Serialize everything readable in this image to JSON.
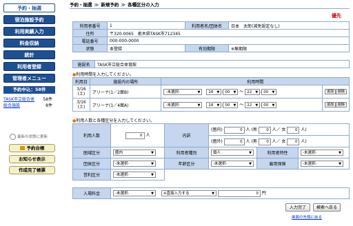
{
  "sidebar": {
    "nav": [
      "予約・抽選",
      "宿泊施設予約",
      "利用実績入力",
      "料金収納",
      "統計",
      "利用者登録",
      "管理者メニュー"
    ],
    "reserve_header": "予約中込：58件",
    "reserve_list": [
      {
        "name": "TASK市立総合体",
        "count": "58件"
      },
      {
        "name": "総合施設",
        "count": "8件"
      }
    ],
    "refresh": "最新の状態に更新",
    "buttons": [
      "予約台帳",
      "お知らせ表示",
      "作成完了帳票"
    ]
  },
  "breadcrumb": [
    "予約・抽選",
    "新規予約",
    "各種区分の入力"
  ],
  "priority": "優先",
  "user": {
    "num_label": "利用者番号",
    "num": "1",
    "name_label": "利用者名/団体名",
    "name": "日本　太郎(減免設定なし)",
    "addr_label": "住所",
    "addr": "〒320-0065　栃木県TASK市712345",
    "tel_label": "電話番号",
    "tel": "000-000-0000",
    "status_label": "状態",
    "status": "本登録",
    "exp_label": "有効期限",
    "exp": "※無期限",
    "fac_label": "施設名",
    "fac": "TASK市立総合体育館"
  },
  "time_section": {
    "instruction": "利用時間を入力してください。",
    "headers": [
      "利用日",
      "施設内の場所",
      "利用時間"
    ],
    "rows": [
      {
        "date": "3/16",
        "dow": "(土)",
        "place": "アリーナ(1／2面B)",
        "sel1": "-未選択-",
        "h1": "18",
        "m1": "00",
        "h2": "22",
        "m2": "00",
        "add": "追加",
        "del": "削除"
      },
      {
        "date": "3/16",
        "dow": "(土)",
        "place": "アリーナ(1／4面A)",
        "sel1": "-未選択-",
        "h1": "18",
        "m1": "00",
        "h2": "22",
        "m2": "00",
        "add": "追加",
        "del": "削除"
      }
    ],
    "tilde": "～",
    "colon": ":"
  },
  "count_section": {
    "instruction": "利用人数と各種区分を入力してください。",
    "people_label": "利用人数",
    "people_value": "0",
    "people_unit": "人",
    "detail_label": "内訳",
    "in_label": "(圏内)",
    "out_label": "(圏外)",
    "val": "0",
    "male": "人 (男",
    "female": "人／ 女",
    "close": "人)",
    "row1": {
      "a": "圏域区分",
      "a_v": "圏内",
      "b": "利用者種別",
      "b_v": "個人",
      "c": "利用者特性",
      "c_v": "-未選択-"
    },
    "row2": {
      "a": "団体区分",
      "a_v": "-未選択-",
      "b": "年齢区分",
      "b_v": "-未選択-",
      "c": "雇用保険",
      "c_v": "-未選択-"
    },
    "row3": {
      "a": "営利区分",
      "a_v": "-未選択-"
    },
    "fee_label": "入場料金",
    "fee_v": "-未選択-",
    "fee2": "※直接入力する",
    "fee_amount": "0",
    "yen": "円"
  },
  "actions": {
    "complete": "入力完了",
    "back": "検索へ戻る",
    "top": "画面の先頭に戻る"
  }
}
